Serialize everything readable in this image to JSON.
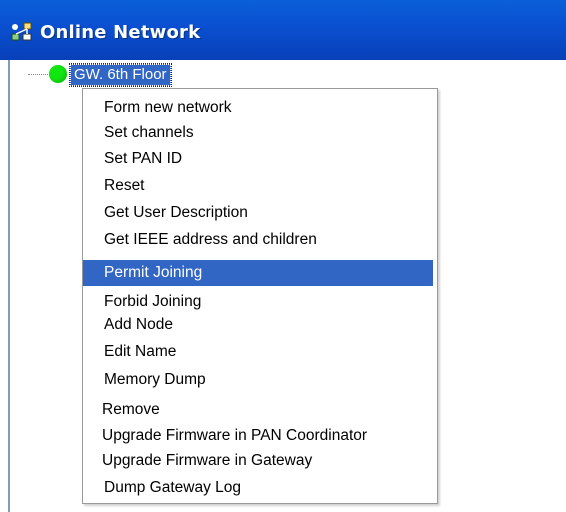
{
  "window": {
    "title": "Online Network",
    "title_icon": "network-icon"
  },
  "tree": {
    "root_node": {
      "label": "GW. 6th Floor",
      "status_color": "#11e611",
      "icon": "status-online-icon"
    }
  },
  "context_menu": {
    "items": [
      {
        "label": "Form new network"
      },
      {
        "label": "Set channels"
      },
      {
        "label": "Set PAN ID"
      },
      {
        "label": "Reset"
      },
      {
        "label": "Get User Description"
      },
      {
        "label": "Get IEEE address and children"
      },
      {
        "label": "Permit Joining",
        "highlighted": true
      },
      {
        "label": "Forbid Joining"
      },
      {
        "label": "Add Node"
      },
      {
        "label": "Edit Name"
      },
      {
        "label": "Memory Dump"
      },
      {
        "label": "Remove"
      },
      {
        "label": "Upgrade Firmware in PAN Coordinator"
      },
      {
        "label": "Upgrade Firmware in Gateway"
      },
      {
        "label": "Dump Gateway Log"
      }
    ]
  },
  "colors": {
    "title_bar": "#0a4fd0",
    "selection": "#3166c5"
  }
}
